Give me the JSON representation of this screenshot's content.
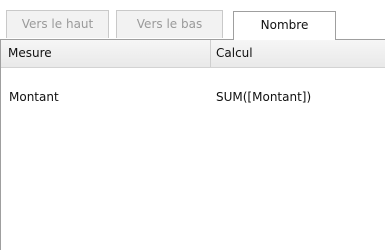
{
  "tabs": [
    {
      "label": "Vers le haut"
    },
    {
      "label": "Vers le bas"
    },
    {
      "label": "Nombre"
    }
  ],
  "grid": {
    "headers": [
      "Mesure",
      "Calcul"
    ],
    "rows": [
      {
        "mesure": "Montant",
        "calcul": "SUM([Montant])"
      }
    ]
  }
}
